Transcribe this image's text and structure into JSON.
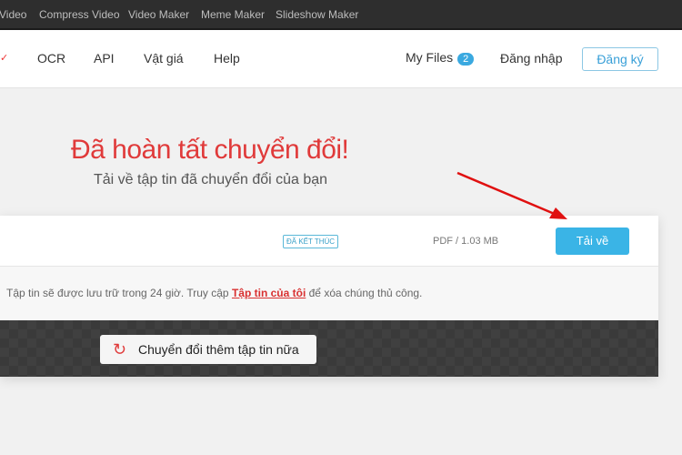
{
  "topbar": {
    "items": [
      "Video",
      "Compress Video",
      "Video Maker",
      "Meme Maker",
      "Slideshow Maker"
    ]
  },
  "nav": {
    "items": [
      "OCR",
      "API",
      "Vật giá",
      "Help"
    ],
    "my_files": "My Files",
    "my_files_count": "2",
    "login": "Đăng nhập",
    "signup": "Đăng ký"
  },
  "hero": {
    "title": "Đã hoàn tất chuyển đổi!",
    "subtitle": "Tải về tập tin đã chuyển đổi của bạn"
  },
  "file": {
    "status": "ĐÃ KẾT THÚC",
    "size": "PDF / 1.03 MB",
    "download": "Tải về"
  },
  "note": {
    "before": "Tập tin sẽ được lưu trữ trong 24 giờ. Truy cập ",
    "link": "Tập tin của tôi",
    "after": " để xóa chúng thủ công."
  },
  "convert_more": "Chuyển đổi thêm tập tin nữa",
  "colors": {
    "accent": "#3ab4e6",
    "red": "#e03a3a"
  }
}
